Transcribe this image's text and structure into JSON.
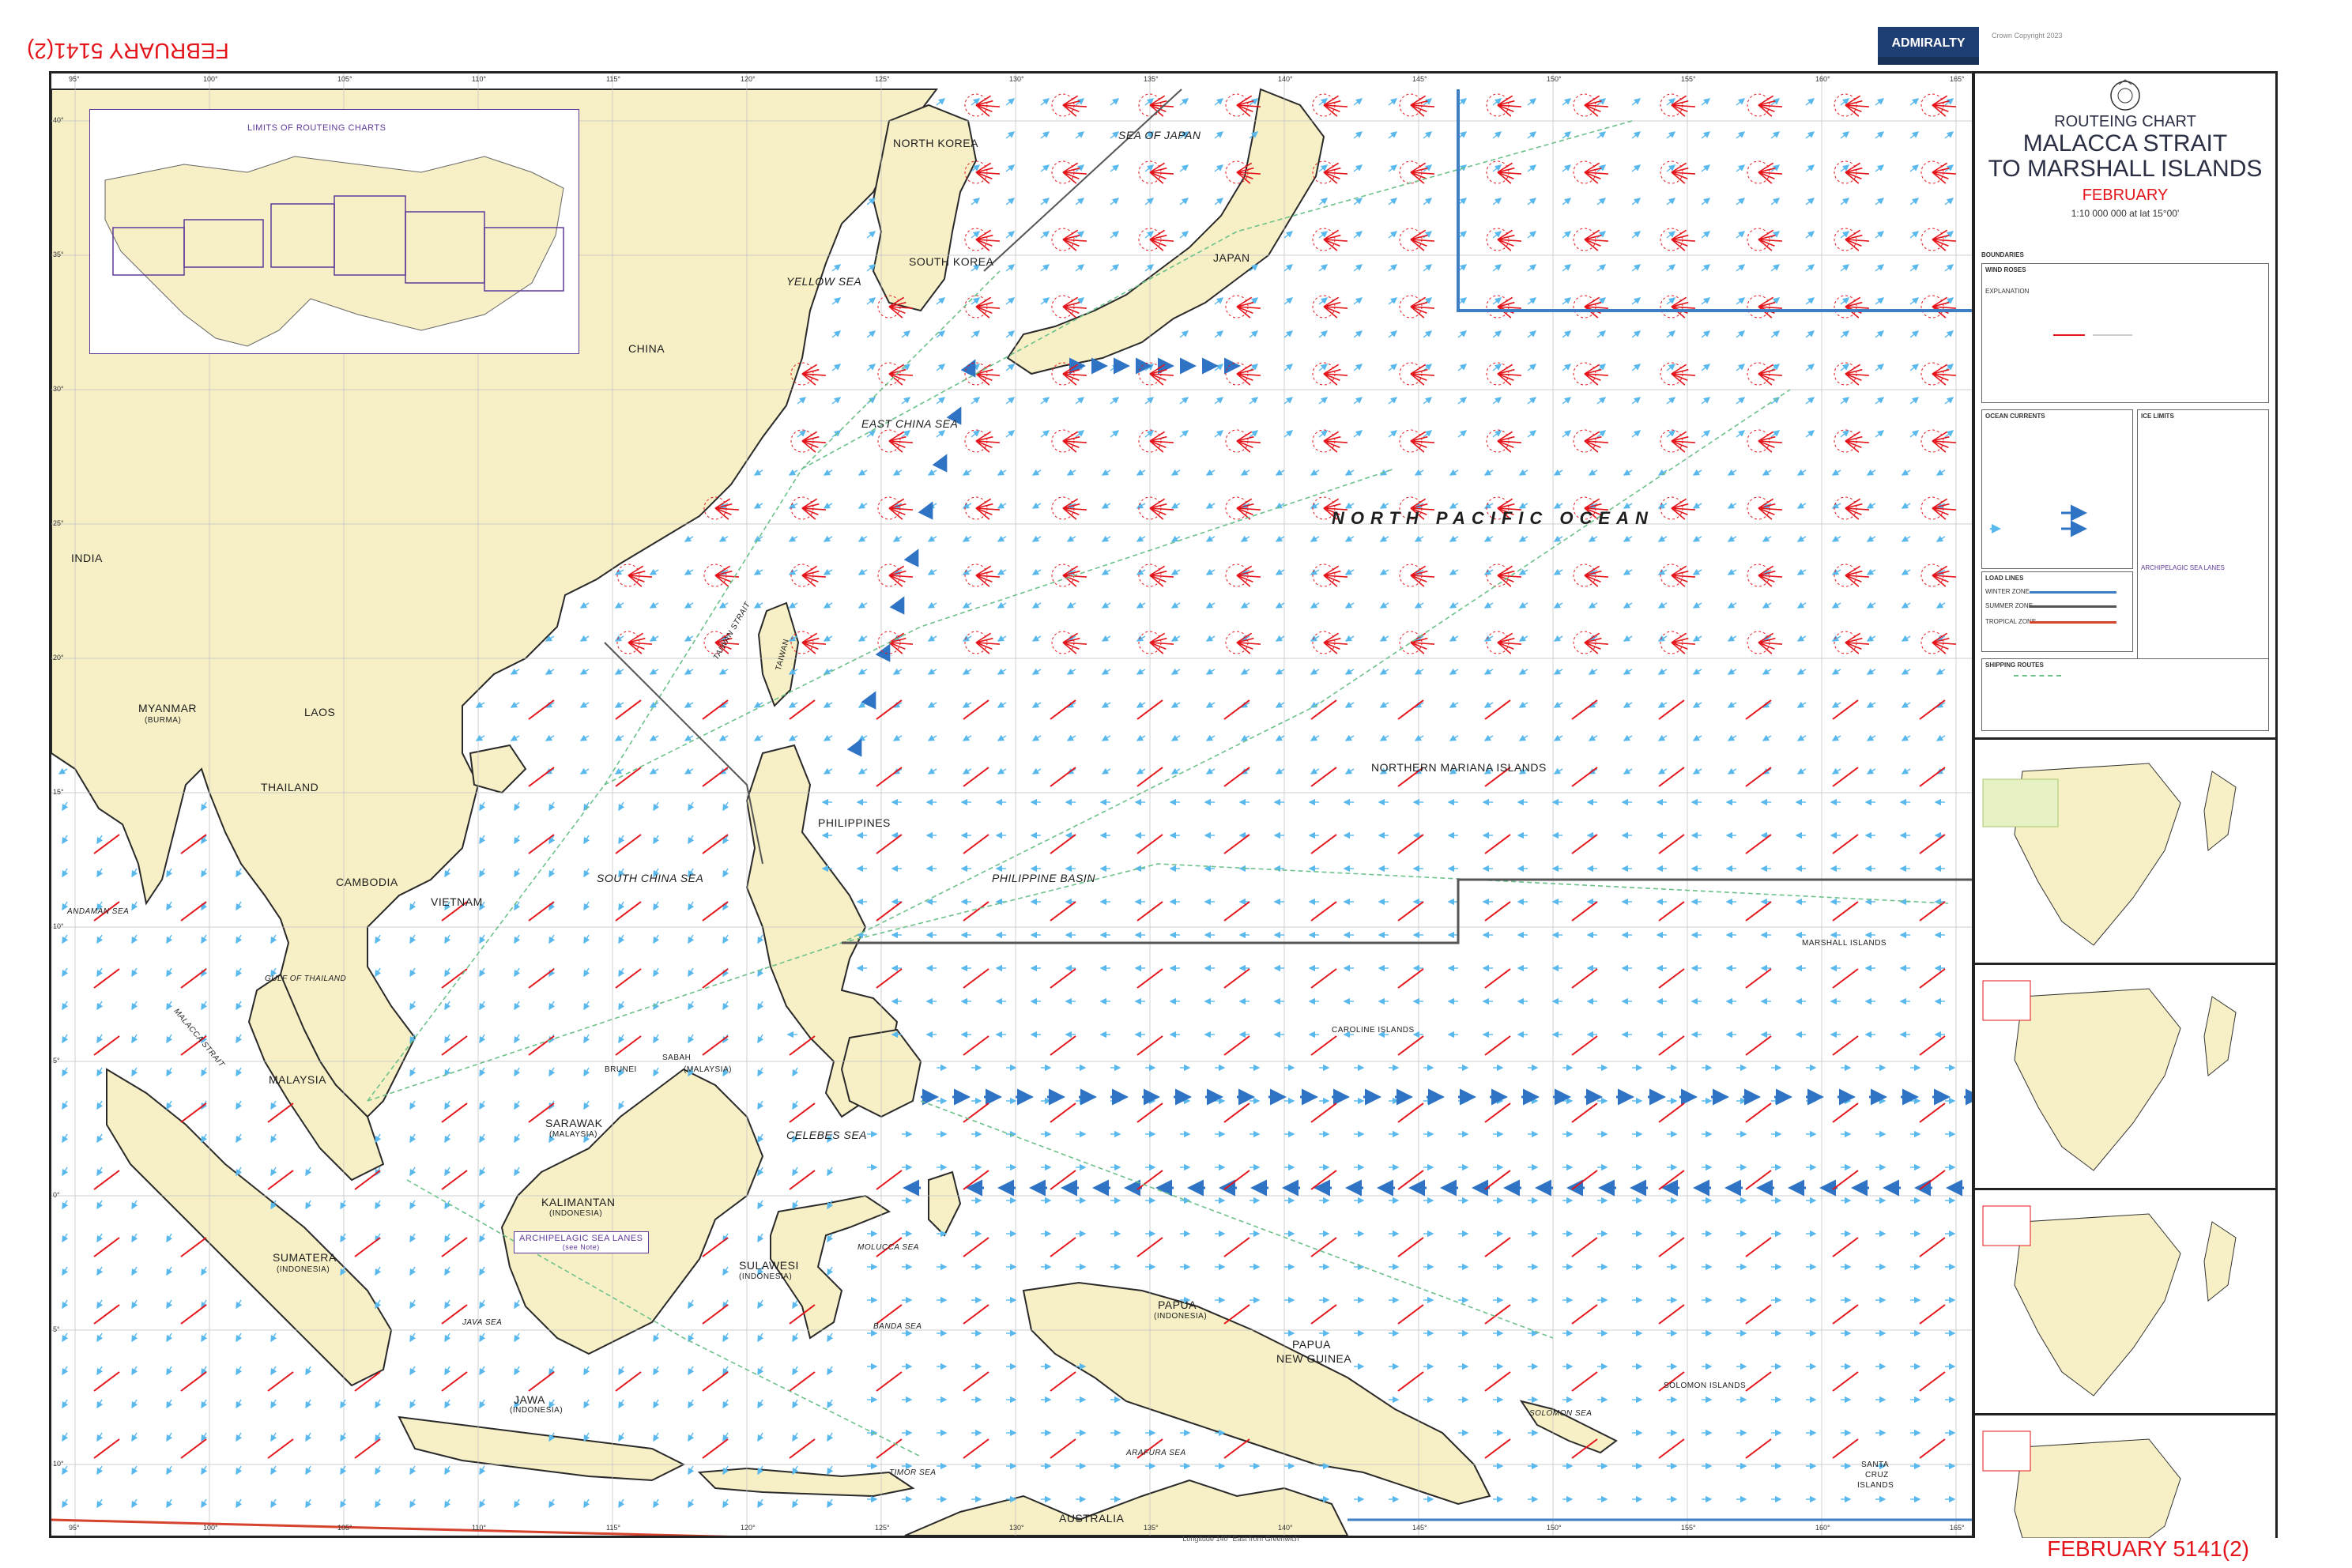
{
  "header": {
    "edition_badge_month": "FEBRUARY",
    "edition_badge_number": "5141(2)",
    "admiralty_logo": "ADMIRALTY",
    "copyright_line": "Crown Copyright 2023"
  },
  "footer": {
    "badge_month": "FEBRUARY",
    "badge_number": "5141(2)",
    "longitude_note": "Longitude 140° East from Greenwich"
  },
  "title_block": {
    "line1": "ROUTEING CHART",
    "line2": "MALACCA STRAIT",
    "line3": "TO MARSHALL ISLANDS",
    "month": "FEBRUARY",
    "scale": "1:10 000 000 at lat 15°00'",
    "crest_icon": "royal-crest-icon"
  },
  "legend": {
    "boundaries_label": "BOUNDARIES",
    "wind_roses_label": "WIND ROSES",
    "explanation_label": "EXPLANATION",
    "ocean_currents_label": "OCEAN CURRENTS",
    "ice_limits_label": "ICE LIMITS",
    "load_lines_label": "LOAD LINES",
    "winter_zone": "WINTER ZONE",
    "summer_zone": "SUMMER ZONE",
    "tropical_zone": "TROPICAL ZONE",
    "archipelagic_sea_lanes": "ARCHIPELAGIC SEA LANES",
    "shipping_routes": "SHIPPING ROUTES"
  },
  "inset_index": {
    "title": "LIMITS OF ROUTEING CHARTS"
  },
  "map_labels": {
    "north_korea": "NORTH KOREA",
    "south_korea": "SOUTH KOREA",
    "japan": "JAPAN",
    "sea_of_japan": "SEA OF JAPAN",
    "yellow_sea": "YELLOW SEA",
    "china": "CHINA",
    "east_china_sea": "EAST CHINA SEA",
    "north_pacific_ocean": "NORTH PACIFIC OCEAN",
    "india": "INDIA",
    "myanmar": "MYANMAR",
    "myanmar_sub": "(BURMA)",
    "laos": "LAOS",
    "thailand": "THAILAND",
    "cambodia": "CAMBODIA",
    "vietnam": "VIETNAM",
    "andaman_sea": "ANDAMAN SEA",
    "gulf_of_thailand": "GULF OF THAILAND",
    "south_china_sea": "SOUTH CHINA SEA",
    "philippines": "PHILIPPINES",
    "philippine_basin": "PHILIPPINE BASIN",
    "taiwan": "TAIWAN",
    "taiwan_strait": "TAIWAN STRAIT",
    "northern_mariana_islands": "NORTHERN MARIANA ISLANDS",
    "marshall_islands": "MARSHALL ISLANDS",
    "caroline_islands": "CAROLINE ISLANDS",
    "malaysia": "MALAYSIA",
    "malacca_strait": "MALACCA STRAIT",
    "brunei": "BRUNEI",
    "sabah": "SABAH",
    "sabah_sub": "(MALAYSIA)",
    "sarawak": "SARAWAK",
    "sarawak_sub": "(MALAYSIA)",
    "kalimantan": "KALIMANTAN",
    "kalimantan_sub": "(INDONESIA)",
    "celebes_sea": "CELEBES SEA",
    "sumatera": "SUMATERA",
    "sumatera_sub": "(INDONESIA)",
    "sulawesi": "SULAWESI",
    "sulawesi_sub": "(INDONESIA)",
    "java_sea": "JAVA SEA",
    "jawa": "JAWA",
    "jawa_sub": "(INDONESIA)",
    "papua": "PAPUA",
    "papua_sub": "(INDONESIA)",
    "papua_new_guinea_1": "PAPUA",
    "papua_new_guinea_2": "NEW GUINEA",
    "solomon_islands": "SOLOMON ISLANDS",
    "santa_cruz_1": "SANTA",
    "santa_cruz_2": "CRUZ",
    "santa_cruz_3": "ISLANDS",
    "australia": "AUSTRALIA",
    "archipelagic_sea_lanes_box": "ARCHIPELAGIC SEA LANES",
    "archipelagic_see_note": "(see Note)",
    "solomon_sea": "SOLOMON SEA",
    "timor_sea": "TIMOR SEA",
    "banda_sea": "BANDA SEA",
    "arafura_sea": "ARAFURA SEA",
    "molucca_sea": "MOLUCCA SEA"
  },
  "graticule": {
    "top_longitudes": [
      "95°",
      "100°",
      "105°",
      "110°",
      "115°",
      "120°",
      "125°",
      "130°",
      "135°",
      "140°",
      "145°",
      "150°",
      "155°",
      "160°",
      "165°"
    ],
    "bottom_longitudes": [
      "95°",
      "100°",
      "105°",
      "110°",
      "115°",
      "120°",
      "125°",
      "130°",
      "135°",
      "140°",
      "145°",
      "150°",
      "155°",
      "160°",
      "165°"
    ],
    "left_latitudes": [
      "40°",
      "35°",
      "30°",
      "25°",
      "20°",
      "15°",
      "10°",
      "5°",
      "0°",
      "5°",
      "10°"
    ]
  },
  "colors": {
    "land": "#f7f0c6",
    "coast": "#2a2a2a",
    "current_arrow": "#59b8ec",
    "strong_current": "#2f73c4",
    "wind_rose": "#e4141b",
    "shipping_route": "#6cc18a",
    "boundary": "#3e7fc4",
    "tropical": "#d6432f"
  }
}
